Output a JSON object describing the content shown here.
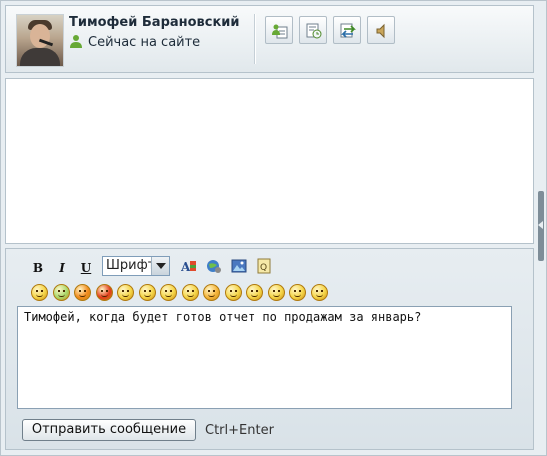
{
  "header": {
    "user_name": "Тимофей Барановский",
    "status_text": "Сейчас на сайте",
    "buttons": [
      {
        "icon": "user-card-icon"
      },
      {
        "icon": "history-clock-icon"
      },
      {
        "icon": "transfer-icon"
      },
      {
        "icon": "speaker-icon"
      }
    ]
  },
  "toolbar": {
    "bold_label": "B",
    "italic_label": "I",
    "underline_label": "U",
    "font_select_value": "Шрифт",
    "tools": [
      "text-color-icon",
      "link-icon",
      "image-icon",
      "quote-icon"
    ]
  },
  "smileys": [
    {
      "icon": "laugh-smiley-icon",
      "color": "#f5d547"
    },
    {
      "icon": "flower-smiley-icon",
      "color": "#a8d86a"
    },
    {
      "icon": "question-smiley-icon",
      "color": "#f28a1c"
    },
    {
      "icon": "exclamation-smiley-icon",
      "color": "#e23b1a"
    },
    {
      "icon": "smile-icon",
      "color": "#f5d547"
    },
    {
      "icon": "angry-smiley-icon",
      "color": "#f5d547"
    },
    {
      "icon": "sad-smiley-icon",
      "color": "#f5d547"
    },
    {
      "icon": "confused-smiley-icon",
      "color": "#f5d547"
    },
    {
      "icon": "tongue-smiley-icon",
      "color": "#f5b53b"
    },
    {
      "icon": "cool-smiley-icon",
      "color": "#f5d547"
    },
    {
      "icon": "grin-smiley-icon",
      "color": "#f5d547"
    },
    {
      "icon": "worried-smiley-icon",
      "color": "#f5d547"
    },
    {
      "icon": "neutral-smiley-icon",
      "color": "#f5d547"
    },
    {
      "icon": "wink-smiley-icon",
      "color": "#f5d547"
    }
  ],
  "compose": {
    "message_text": "Тимофей, когда будет готов отчет по продажам за январь?",
    "send_label": "Отправить сообщение",
    "shortcut_hint": "Ctrl+Enter"
  }
}
